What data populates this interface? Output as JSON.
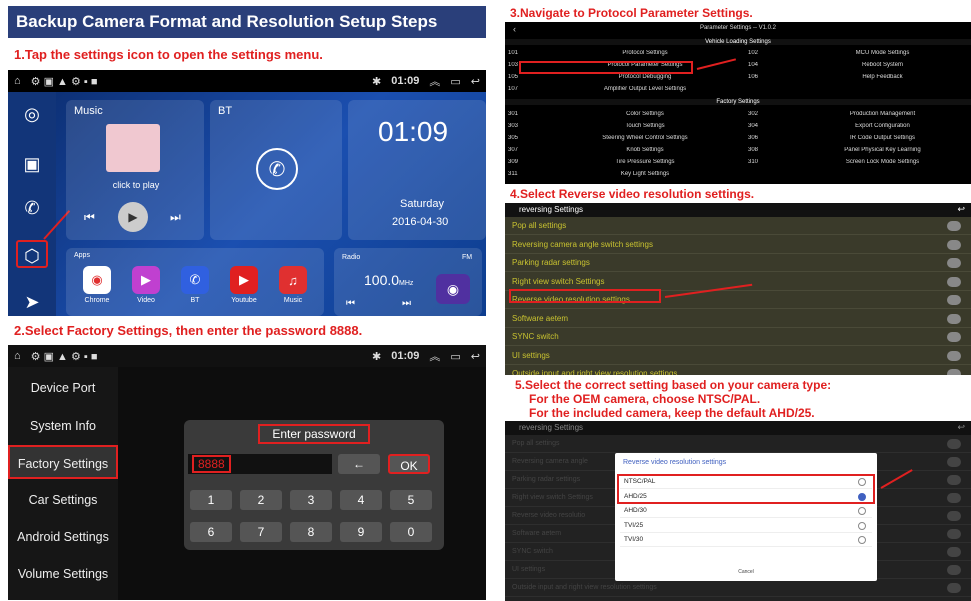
{
  "title": "Backup Camera Format and Resolution Setup Steps",
  "steps": {
    "s1": "1.Tap the settings icon to open the settings menu.",
    "s2": "2.Select Factory Settings, then enter the password 8888.",
    "s3": "3.Navigate to Protocol Parameter Settings.",
    "s4": "4.Select Reverse video resolution settings.",
    "s5a": "5.Select the correct setting based on your camera type:",
    "s5b": "For the OEM camera, choose NTSC/PAL.",
    "s5c": "For the included camera, keep the default AHD/25."
  },
  "status": {
    "time": "01:09"
  },
  "home": {
    "music_label": "Music",
    "click_to_play": "click to play",
    "bt_label": "BT",
    "clock": "01:09",
    "day": "Saturday",
    "date": "2016-04-30",
    "apps_label": "Apps",
    "apps": [
      {
        "name": "Chrome",
        "color": "#ffffff",
        "glyph": "◉"
      },
      {
        "name": "Video",
        "color": "#c040d0",
        "glyph": "▶"
      },
      {
        "name": "BT",
        "color": "#3060e0",
        "glyph": "✆"
      },
      {
        "name": "Youtube",
        "color": "#e02020",
        "glyph": "▶"
      },
      {
        "name": "Music",
        "color": "#e03030",
        "glyph": "♫"
      }
    ],
    "radio_label": "Radio",
    "fm": "FM",
    "freq": "100.0",
    "freq_unit": "MHz"
  },
  "settings_menu": {
    "items": [
      "Device Port",
      "System Info",
      "Factory Settings",
      "Car Settings",
      "Android Settings",
      "Volume Settings"
    ]
  },
  "password": {
    "title": "Enter password",
    "value": "8888",
    "back": "←",
    "ok": "OK",
    "keys": [
      "1",
      "2",
      "3",
      "4",
      "5",
      "6",
      "7",
      "8",
      "9",
      "0"
    ]
  },
  "params": {
    "header": "Parameter Settings -- V1.0.2",
    "section1": "Vehicle Loading Settings",
    "rows1": [
      [
        "101",
        "Protocol Settings",
        "102",
        "MCU Mode Settings"
      ],
      [
        "103",
        "Protocol Parameter Settings",
        "104",
        "Reboot System"
      ],
      [
        "105",
        "Protocol Debugging",
        "106",
        "Help Feedback"
      ],
      [
        "107",
        "Amplifier Output Level Settings",
        "",
        ""
      ]
    ],
    "section2": "Factory Settings",
    "rows2": [
      [
        "301",
        "Color Settings",
        "302",
        "Production Management"
      ],
      [
        "303",
        "Touch Settings",
        "304",
        "Export Configuration"
      ],
      [
        "305",
        "Steering Wheel Control Settings",
        "306",
        "IR Code Output Settings"
      ],
      [
        "307",
        "Knob Settings",
        "308",
        "Panel Physical Key Learning"
      ],
      [
        "309",
        "Tire Pressure Settings",
        "310",
        "Screen Lock Mode Settings"
      ],
      [
        "311",
        "Key Light Settings",
        "",
        ""
      ]
    ]
  },
  "reversing": {
    "title": "reversing Settings",
    "items": [
      "Pop all settings",
      "Reversing camera angle switch settings",
      "Parking radar settings",
      "Right view switch Settings",
      "Reverse video resolution settings",
      "Software aetem",
      "SYNC switch",
      "UI settings",
      "Outside input and right view resolution settings"
    ]
  },
  "resolution": {
    "title": "Reverse video resolution settings",
    "options": [
      "NTSC/PAL",
      "AHD/25",
      "AHD/30",
      "TVI/25",
      "TVI/30"
    ],
    "selected_index": 1,
    "cancel": "Cancel",
    "bg_items": [
      "Pop all settings",
      "Reversing camera angle",
      "Parking radar settings",
      "Right view switch Settings",
      "Reverse video resolutio",
      "Software aetem",
      "SYNC switch",
      "UI settings",
      "Outside input and right view resolution settings"
    ]
  }
}
